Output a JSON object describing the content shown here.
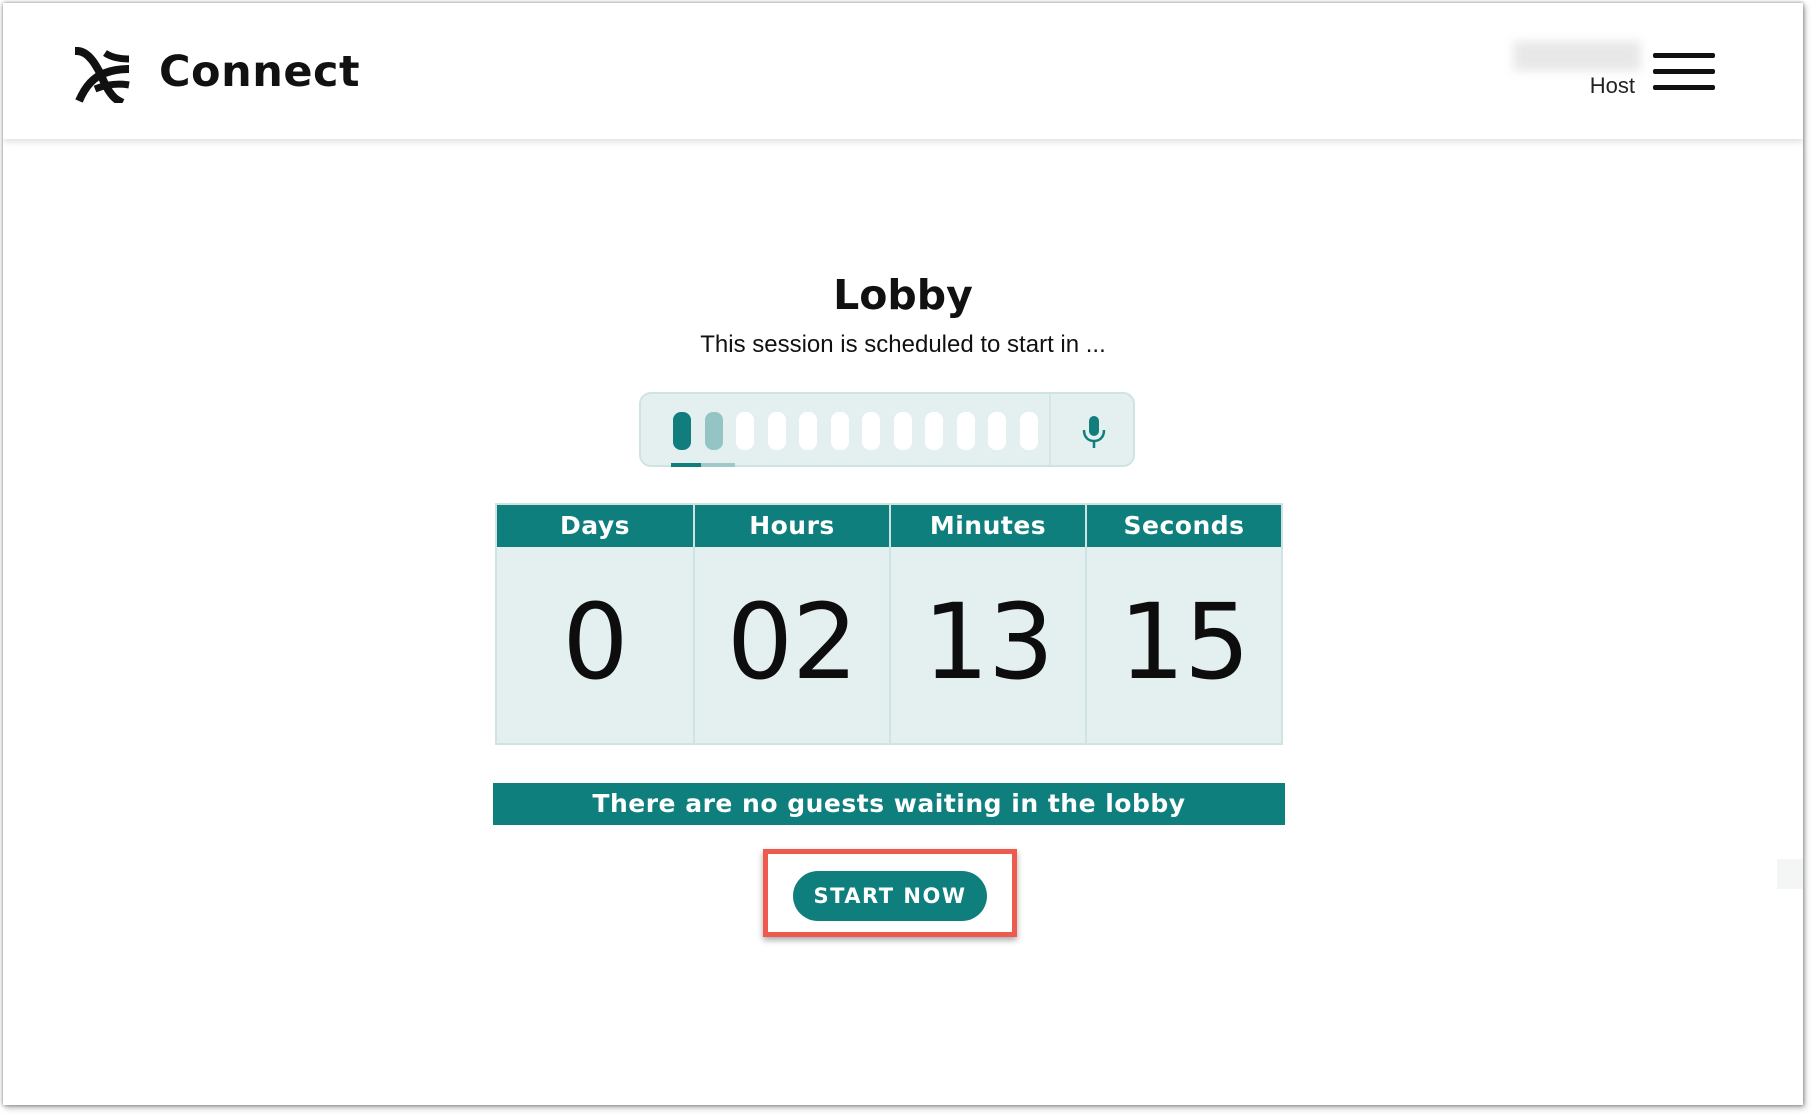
{
  "header": {
    "app_name": "Connect",
    "user_role": "Host",
    "logo_icon": "connect-logo-icon",
    "menu_icon": "hamburger-menu-icon"
  },
  "lobby": {
    "title": "Lobby",
    "subtitle": "This session is scheduled to start in ..."
  },
  "mic_meter": {
    "icon": "microphone-icon",
    "bars_total": 12,
    "bars_active": 2,
    "colors": {
      "active": "#117d7d",
      "partial": "#94c4c4",
      "idle": "#ffffff"
    }
  },
  "countdown": {
    "units": [
      {
        "label": "Days",
        "value": "0"
      },
      {
        "label": "Hours",
        "value": "02"
      },
      {
        "label": "Minutes",
        "value": "13"
      },
      {
        "label": "Seconds",
        "value": "15"
      }
    ]
  },
  "guests_message": "There are no guests waiting in the lobby",
  "start_button_label": "START NOW",
  "colors": {
    "accent": "#0f7f7e",
    "panel_bg": "#e4f0f0",
    "highlight": "#ee5a4e"
  }
}
